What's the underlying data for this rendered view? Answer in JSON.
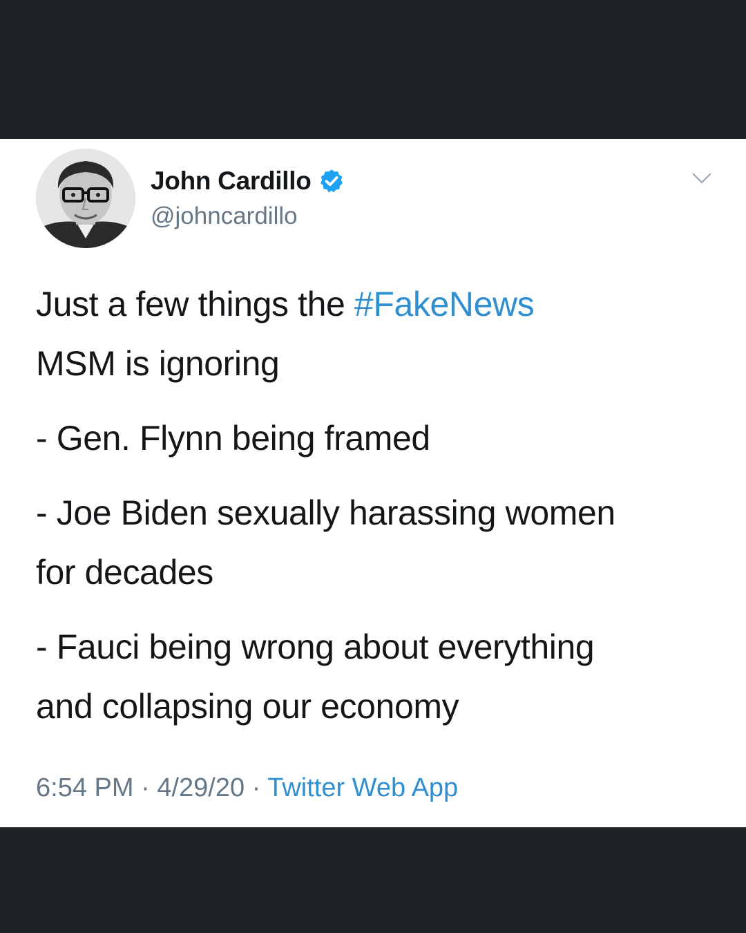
{
  "tweet": {
    "display_name": "John Cardillo",
    "handle": "@johncardillo",
    "verified_icon": "verified-badge-icon",
    "menu_icon": "chevron-down-icon",
    "text_intro": "Just a few things the ",
    "hashtag": "#FakeNews",
    "text_intro_line2": "MSM is ignoring",
    "item_1": "- Gen. Flynn being framed",
    "item_2_line1": "- Joe Biden sexually harassing women",
    "item_2_line2": "for decades",
    "item_3_line1": "- Fauci being wrong about everything",
    "item_3_line2": "and collapsing our economy",
    "time": "6:54 PM",
    "separator": "·",
    "date": "4/29/20",
    "source": "Twitter Web App"
  },
  "colors": {
    "link": "#2f8fd1",
    "background_band": "#1f2227",
    "secondary_text": "#657786",
    "verified": "#1da1f2"
  }
}
